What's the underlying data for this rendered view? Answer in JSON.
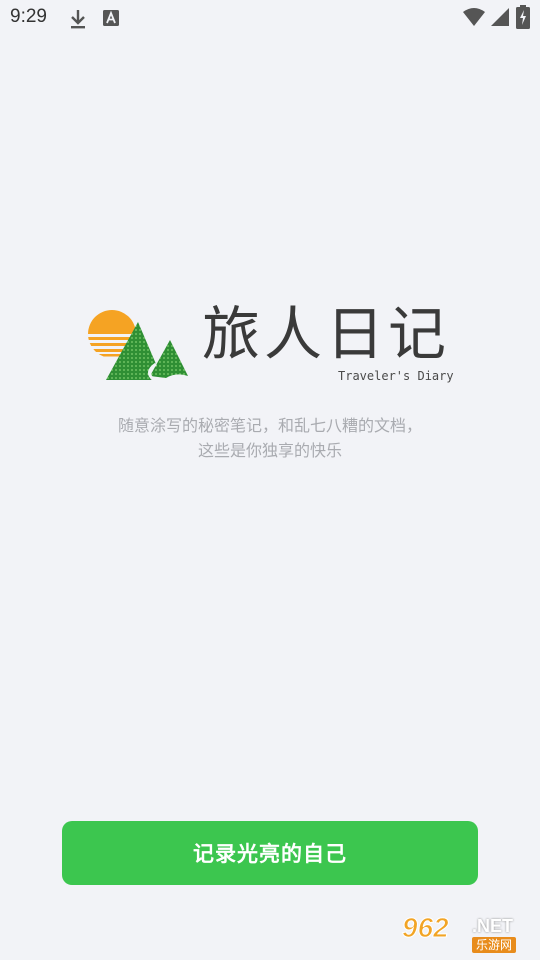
{
  "status_bar": {
    "time": "9:29",
    "icons": [
      "download-icon",
      "font-app-icon",
      "wifi-icon",
      "signal-icon",
      "battery-charging-icon"
    ]
  },
  "logo": {
    "title": "旅人日记",
    "subtitle": "Traveler's Diary",
    "icon": "sun-mountain-logo-icon"
  },
  "tagline": {
    "line1": "随意涂写的秘密笔记，和乱七八糟的文档，",
    "line2": "这些是你独享的快乐"
  },
  "cta": {
    "label": "记录光亮的自己"
  },
  "watermark": {
    "number": "962",
    "domain": ".NET",
    "name": "乐游网"
  },
  "colors": {
    "background": "#f2f3f7",
    "accent_green": "#3cc64f",
    "sun_orange": "#f5a323",
    "mountain_green": "#3a9a3a",
    "tagline_gray": "#a9abb0"
  }
}
